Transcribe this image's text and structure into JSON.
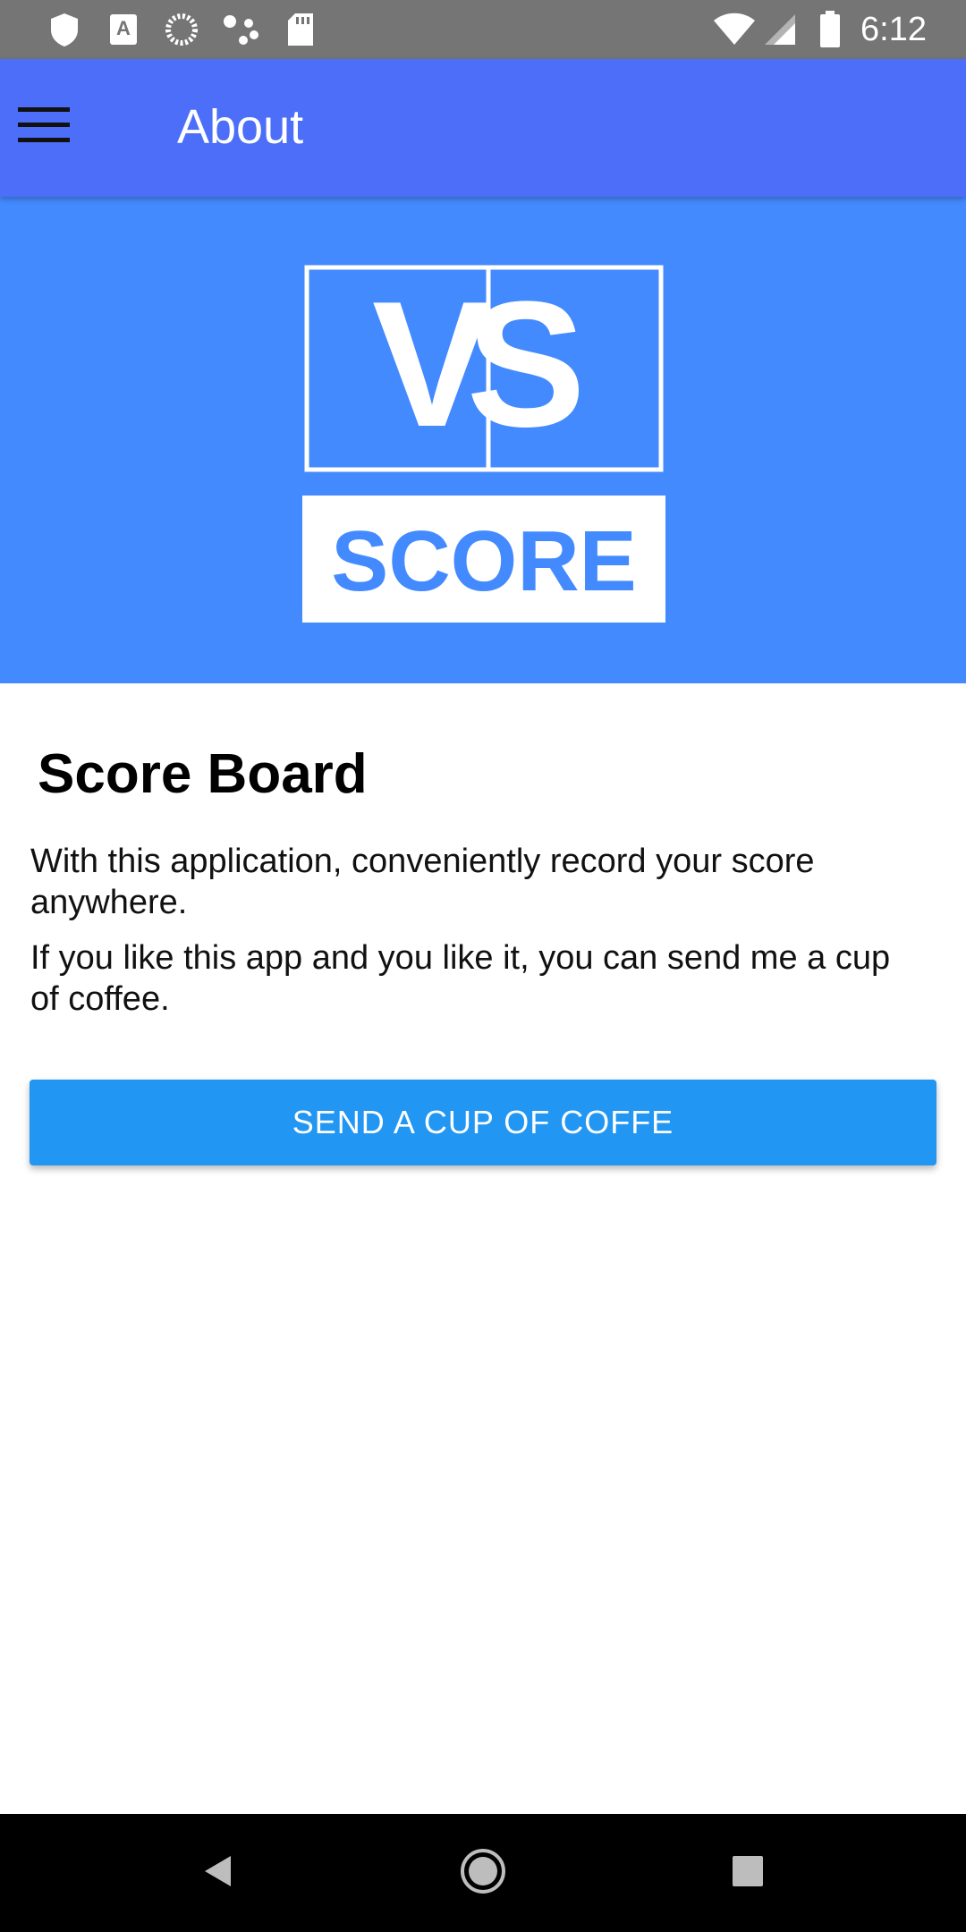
{
  "status_bar": {
    "time": "6:12",
    "left_icons": [
      "shield-icon",
      "a-notification-icon",
      "sync-icon",
      "assistant-dots-icon",
      "sd-card-icon"
    ],
    "right_icons": [
      "wifi-icon",
      "signal-icon",
      "battery-icon"
    ]
  },
  "app_bar": {
    "title": "About",
    "menu_icon": "hamburger-menu-icon"
  },
  "banner": {
    "logo_top": "VS",
    "logo_bottom": "SCORE"
  },
  "content": {
    "heading": "Score Board",
    "paragraph_1": "With this application, conveniently record your score anywhere.",
    "paragraph_2": "If you like this app and you like it, you can send me a cup of coffee.",
    "button_label": "SEND A CUP OF COFFE"
  },
  "nav_bar": {
    "buttons": [
      "back-icon",
      "home-icon",
      "recents-icon"
    ]
  },
  "colors": {
    "status_bar": "#757575",
    "app_bar": "#4c6ef8",
    "banner": "#448aff",
    "button": "#2196f3",
    "nav_bar": "#000000"
  }
}
